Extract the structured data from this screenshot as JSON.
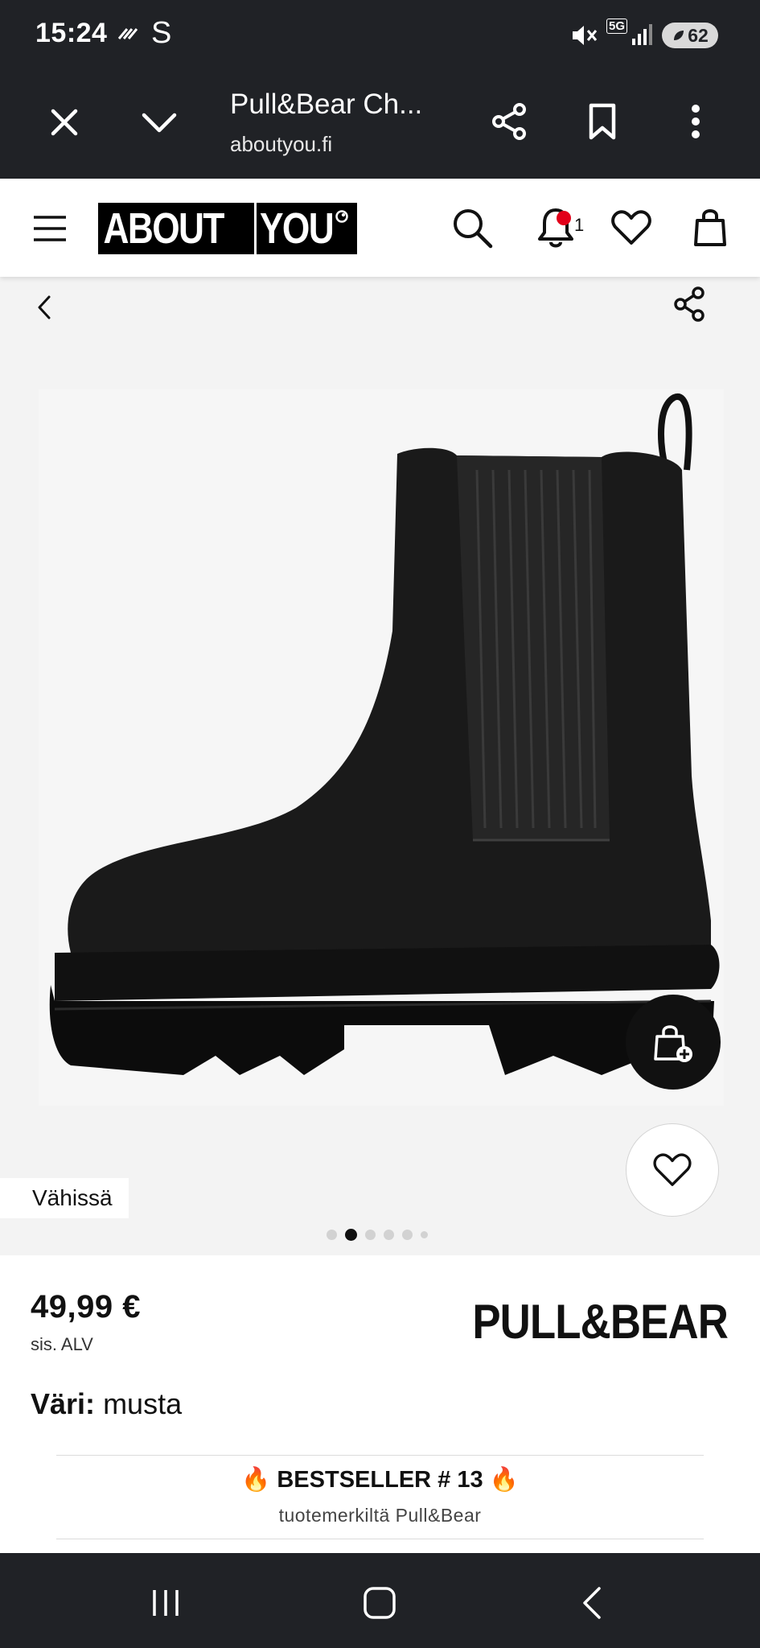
{
  "status_bar": {
    "time": "15:24",
    "carrier_glyph": "S",
    "network": "5G",
    "battery": "62",
    "icons": [
      "missed-call-icon",
      "mute-icon",
      "signal-icon",
      "battery-saver-icon"
    ]
  },
  "browser": {
    "tab_title": "Pull&Bear Ch...",
    "url": "aboutyou.fi",
    "icons": [
      "close-icon",
      "chevron-down-icon",
      "share-icon",
      "bookmark-icon",
      "more-icon"
    ]
  },
  "site_header": {
    "logo_part1": "ABOUT",
    "logo_part2": "YOU",
    "notification_count": "1",
    "icons": [
      "menu-icon",
      "search-icon",
      "bell-icon",
      "heart-icon",
      "bag-icon"
    ]
  },
  "gallery": {
    "badge": "Vähissä",
    "slide_count": 6,
    "active_slide": 2,
    "icons": [
      "back-icon",
      "share-nodes-icon",
      "add-to-bag-icon",
      "heart-icon"
    ]
  },
  "product": {
    "price": "49,99 €",
    "vat_note": "sis. ALV",
    "brand": "PULL&BEAR",
    "color_label": "Väri:",
    "color_value": "musta",
    "bestseller": "🔥 BESTSELLER # 13 🔥",
    "bestseller_brand_line": "tuotemerkiltä Pull&Bear"
  },
  "nav_bar": {
    "icons": [
      "recents-icon",
      "home-icon",
      "back-icon"
    ]
  },
  "colors": {
    "system_bar": "#202226",
    "gallery_bg": "#f3f3f3",
    "notification_dot": "#e2001a",
    "text": "#111111"
  }
}
